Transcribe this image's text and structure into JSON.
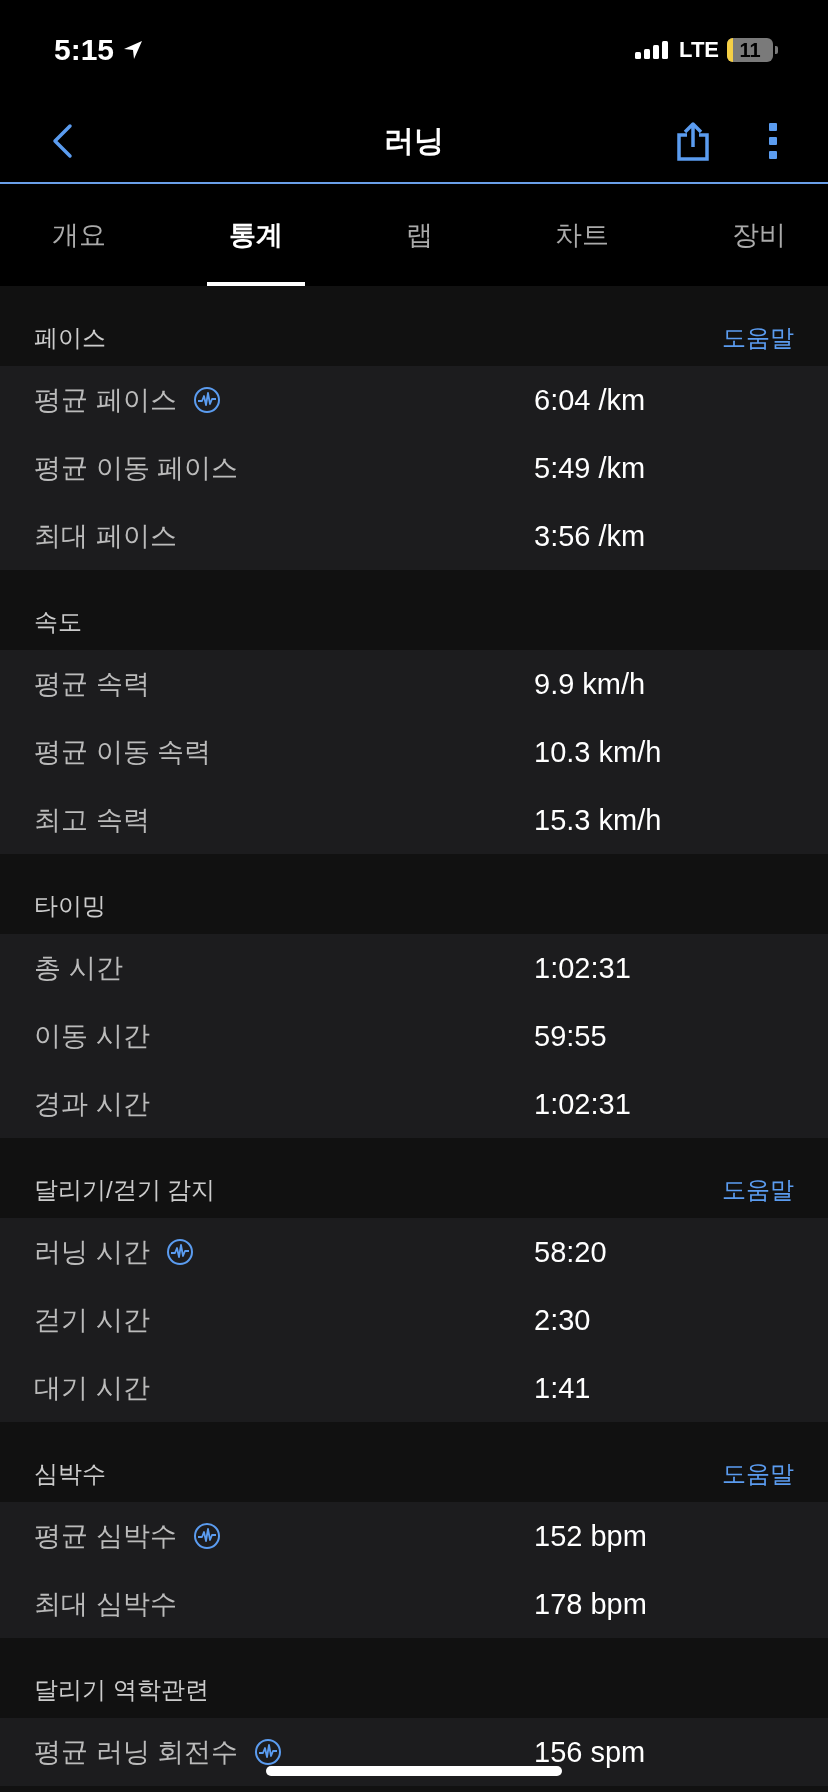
{
  "status_bar": {
    "time": "5:15",
    "network": "LTE",
    "battery": "11"
  },
  "header": {
    "title": "러닝"
  },
  "tabs": [
    {
      "label": "개요",
      "selected": false
    },
    {
      "label": "통계",
      "selected": true
    },
    {
      "label": "랩",
      "selected": false
    },
    {
      "label": "차트",
      "selected": false
    },
    {
      "label": "장비",
      "selected": false
    }
  ],
  "sections": [
    {
      "title": "페이스",
      "help": "도움말",
      "rows": [
        {
          "label": "평균 페이스",
          "chart_link": true,
          "value": "6:04 /km"
        },
        {
          "label": "평균 이동 페이스",
          "chart_link": false,
          "value": "5:49 /km"
        },
        {
          "label": "최대 페이스",
          "chart_link": false,
          "value": "3:56 /km"
        }
      ]
    },
    {
      "title": "속도",
      "rows": [
        {
          "label": "평균 속력",
          "chart_link": false,
          "value": "9.9 km/h"
        },
        {
          "label": "평균 이동 속력",
          "chart_link": false,
          "value": "10.3 km/h"
        },
        {
          "label": "최고 속력",
          "chart_link": false,
          "value": "15.3 km/h"
        }
      ]
    },
    {
      "title": "타이밍",
      "rows": [
        {
          "label": "총 시간",
          "chart_link": false,
          "value": "1:02:31"
        },
        {
          "label": "이동 시간",
          "chart_link": false,
          "value": "59:55"
        },
        {
          "label": "경과 시간",
          "chart_link": false,
          "value": "1:02:31"
        }
      ]
    },
    {
      "title": "달리기/걷기 감지",
      "help": "도움말",
      "rows": [
        {
          "label": "러닝 시간",
          "chart_link": true,
          "value": "58:20"
        },
        {
          "label": "걷기 시간",
          "chart_link": false,
          "value": "2:30"
        },
        {
          "label": "대기 시간",
          "chart_link": false,
          "value": "1:41"
        }
      ]
    },
    {
      "title": "심박수",
      "help": "도움말",
      "rows": [
        {
          "label": "평균 심박수",
          "chart_link": true,
          "value": "152 bpm"
        },
        {
          "label": "최대 심박수",
          "chart_link": false,
          "value": "178 bpm"
        }
      ]
    },
    {
      "title": "달리기 역학관련",
      "rows": [
        {
          "label": "평균 러닝 회전수",
          "chart_link": true,
          "value": "156 spm"
        }
      ]
    }
  ]
}
